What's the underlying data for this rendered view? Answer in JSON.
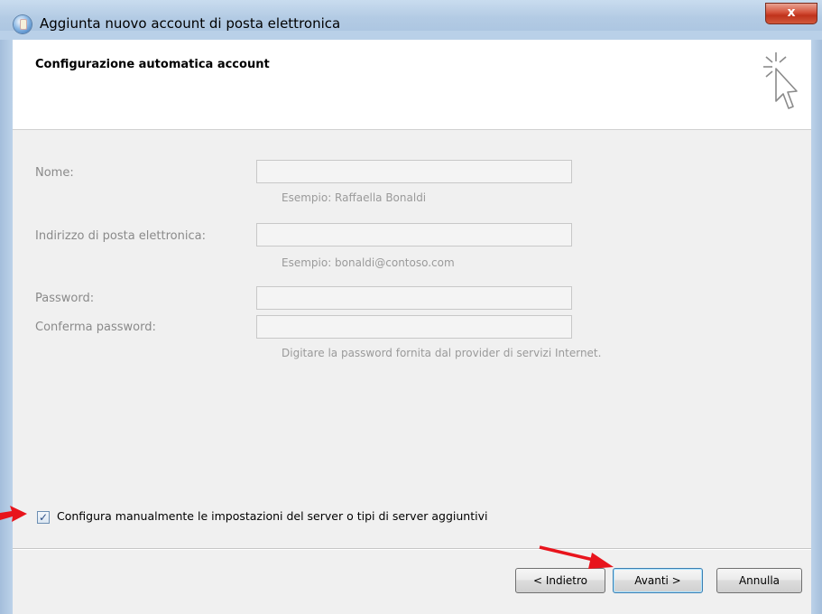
{
  "window": {
    "title": "Aggiunta nuovo account di posta elettronica",
    "close_label": "x"
  },
  "header": {
    "title": "Configurazione automatica account"
  },
  "form": {
    "name": {
      "label": "Nome:",
      "value": "",
      "hint": "Esempio: Raffaella Bonaldi"
    },
    "email": {
      "label": "Indirizzo di posta elettronica:",
      "value": "",
      "hint": "Esempio: bonaldi@contoso.com"
    },
    "password": {
      "label": "Password:",
      "value": ""
    },
    "confirm_password": {
      "label": "Conferma password:",
      "value": "",
      "hint": "Digitare la password fornita dal provider di servizi Internet."
    }
  },
  "manual_config": {
    "checked": true,
    "label": "Configura manualmente le impostazioni del server o tipi di server aggiuntivi"
  },
  "buttons": {
    "back": "< Indietro",
    "next": "Avanti >",
    "cancel": "Annulla"
  },
  "colors": {
    "annotation_arrow": "#e8141c",
    "titlebar": "#b3cbe4",
    "close_button": "#c0321b"
  }
}
